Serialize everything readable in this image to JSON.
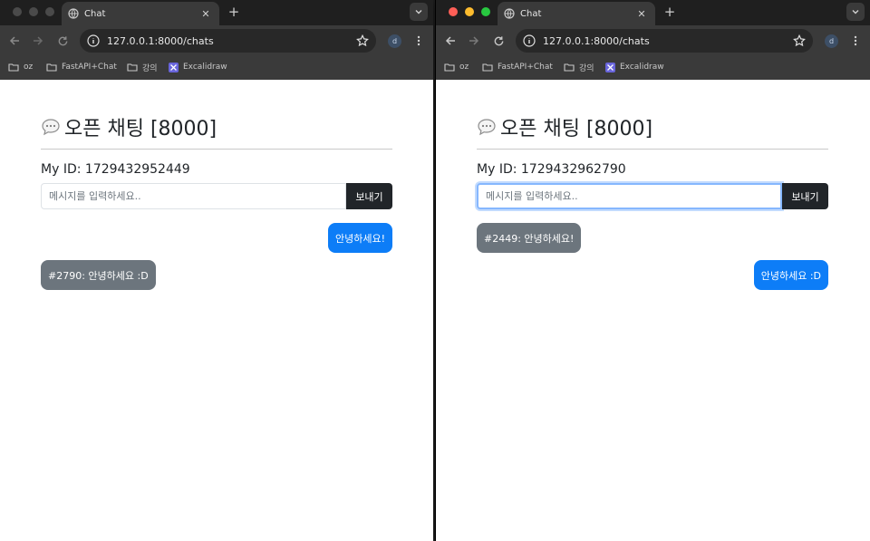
{
  "windows": [
    {
      "tab_title": "Chat",
      "url": "127.0.0.1:8000/chats",
      "profile_initial": "d",
      "bookmarks": [
        "oz",
        "FastAPI+Chat",
        "강의",
        "Excalidraw"
      ],
      "heading": "오픈 채팅 [8000]",
      "my_id": "My ID: 1729432952449",
      "input_placeholder": "메시지를 입력하세요..",
      "send_label": "보내기",
      "messages": [
        {
          "text": "안녕하세요!",
          "side": "mine"
        },
        {
          "text": "#2790: 안녕하세요 :D",
          "side": "other"
        }
      ]
    },
    {
      "tab_title": "Chat",
      "url": "127.0.0.1:8000/chats",
      "profile_initial": "d",
      "bookmarks": [
        "oz",
        "FastAPI+Chat",
        "강의",
        "Excalidraw"
      ],
      "heading": "오픈 채팅 [8000]",
      "my_id": "My ID: 1729432962790",
      "input_placeholder": "메시지를 입력하세요..",
      "send_label": "보내기",
      "messages": [
        {
          "text": "#2449: 안녕하세요!",
          "side": "other"
        },
        {
          "text": "안녕하세요 :D",
          "side": "mine"
        }
      ]
    }
  ],
  "colors": {
    "mine_bubble": "#0d7df7",
    "other_bubble": "#6c757d",
    "send_button": "#212529"
  }
}
